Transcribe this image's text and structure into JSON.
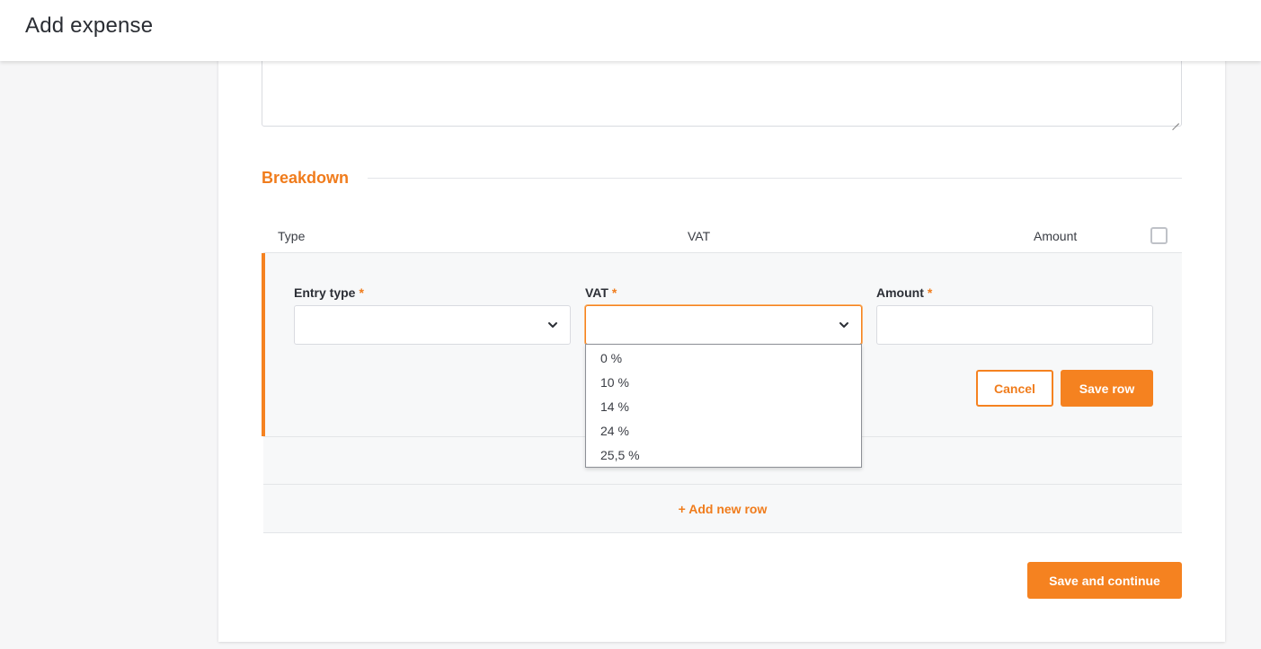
{
  "header": {
    "title": "Add expense"
  },
  "breakdown": {
    "title": "Breakdown",
    "columns": {
      "type": "Type",
      "vat": "VAT",
      "amount": "Amount"
    }
  },
  "form": {
    "entry_type": {
      "label": "Entry type",
      "required_mark": "*",
      "value": ""
    },
    "vat": {
      "label": "VAT",
      "required_mark": "*",
      "value": "",
      "options": [
        "0 %",
        "10 %",
        "14 %",
        "24 %",
        "25,5 %"
      ]
    },
    "amount": {
      "label": "Amount",
      "required_mark": "*",
      "value": ""
    },
    "cancel_label": "Cancel",
    "save_row_label": "Save row"
  },
  "add_row_label": "+ Add new row",
  "save_continue_label": "Save and continue",
  "icons": {
    "select_arrow": "chevron-down-icon",
    "textarea_resize": "resize-handle-icon"
  },
  "colors": {
    "accent": "#f58220",
    "accent_text": "#f07c1c"
  }
}
